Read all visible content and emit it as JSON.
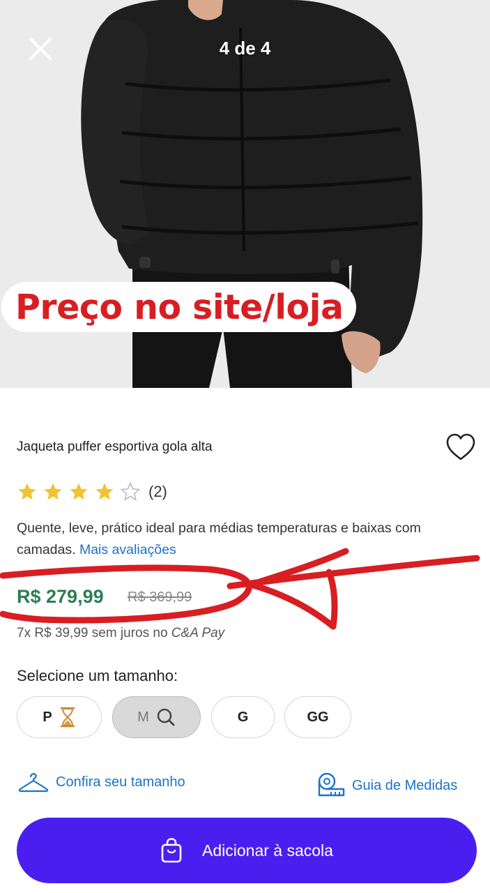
{
  "gallery": {
    "counter": "4 de 4",
    "promo_text": "Preço no site/loja"
  },
  "product": {
    "title": "Jaqueta puffer esportiva gola alta",
    "rating": {
      "value": 4,
      "max": 5,
      "count_text": "(2)"
    },
    "description": "Quente, leve, prático ideal para médias temperaturas e baixas com camadas.",
    "more_reviews_link": "Mais avaliações",
    "price": "R$ 279,99",
    "old_price": "R$ 369,99",
    "installments_prefix": "7x R$ 39,99 sem juros no",
    "installments_brand": "C&A Pay"
  },
  "sizes": {
    "title": "Selecione um tamanho:",
    "options": [
      {
        "label": "P",
        "icon": "hourglass-icon",
        "selected": false
      },
      {
        "label": "M",
        "icon": "search-icon",
        "selected": true
      },
      {
        "label": "G",
        "icon": "",
        "selected": false
      },
      {
        "label": "GG",
        "icon": "",
        "selected": false
      }
    ]
  },
  "links": {
    "check_size": "Confira seu tamanho",
    "size_guide": "Guia de Medidas"
  },
  "cta": {
    "label": "Adicionar à sacola"
  },
  "colors": {
    "price_green": "#2d7d57",
    "link_blue": "#1b73c9",
    "cta_purple": "#4b1ef0",
    "annotation_red": "#d81e22",
    "star_gold": "#f2c230"
  }
}
